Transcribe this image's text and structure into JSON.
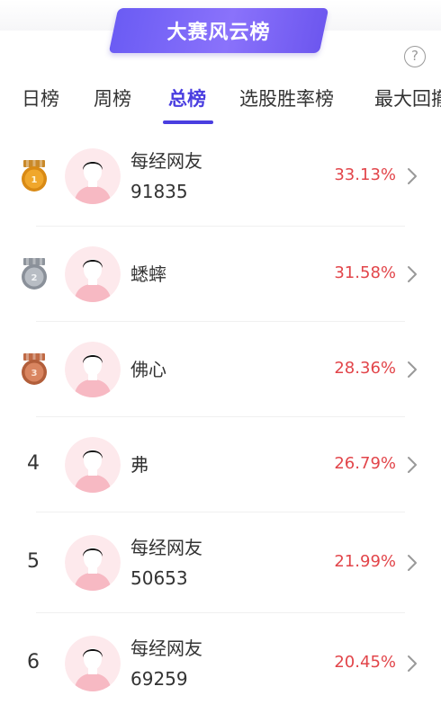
{
  "banner": {
    "title": "大赛风云榜"
  },
  "help": {
    "icon": "question-circle-icon",
    "glyph": "?"
  },
  "tabs": [
    {
      "label": "日榜",
      "active": false
    },
    {
      "label": "周榜",
      "active": false
    },
    {
      "label": "总榜",
      "active": true
    },
    {
      "label": "选股胜率榜",
      "active": false
    },
    {
      "label": "最大回撤",
      "active": false
    }
  ],
  "colors": {
    "accent": "#4a3ee0",
    "banner": "#7b66f7",
    "rate": "#e2454a"
  },
  "ranking": [
    {
      "rank": "1",
      "medal": "gold-medal-icon",
      "name_line1": "每经网友",
      "name_line2": "91835",
      "rate": "33.13%"
    },
    {
      "rank": "2",
      "medal": "silver-medal-icon",
      "name_line1": "蟋蟀",
      "name_line2": "",
      "rate": "31.58%"
    },
    {
      "rank": "3",
      "medal": "bronze-medal-icon",
      "name_line1": "佛心",
      "name_line2": "",
      "rate": "28.36%"
    },
    {
      "rank": "4",
      "medal": "",
      "name_line1": "弗",
      "name_line2": "",
      "rate": "26.79%"
    },
    {
      "rank": "5",
      "medal": "",
      "name_line1": "每经网友",
      "name_line2": "50653",
      "rate": "21.99%"
    },
    {
      "rank": "6",
      "medal": "",
      "name_line1": "每经网友",
      "name_line2": "69259",
      "rate": "20.45%"
    }
  ]
}
